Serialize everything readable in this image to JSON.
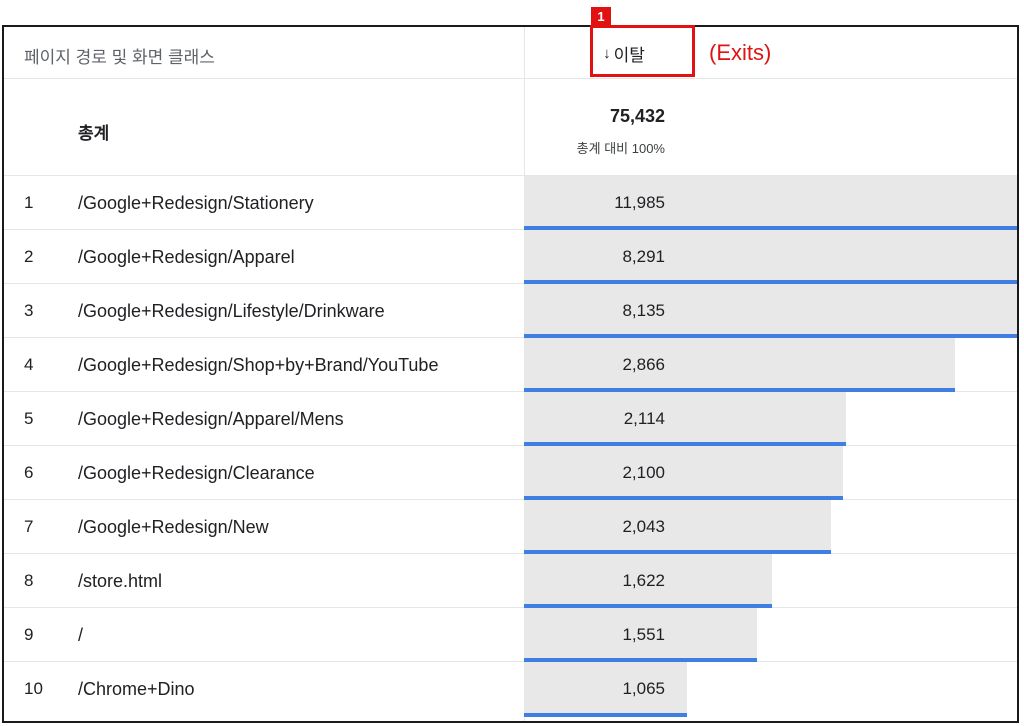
{
  "header": {
    "dimension_label": "페이지 경로 및 화면 클래스",
    "metric_label": "이탈",
    "sort_arrow": "↓"
  },
  "total": {
    "label": "총계",
    "value": "75,432",
    "sub": "총계 대비 100%"
  },
  "rows": [
    {
      "rank": "1",
      "path": "/Google+Redesign/Stationery",
      "value": "11,985"
    },
    {
      "rank": "2",
      "path": "/Google+Redesign/Apparel",
      "value": "8,291"
    },
    {
      "rank": "3",
      "path": "/Google+Redesign/Lifestyle/Drinkware",
      "value": "8,135"
    },
    {
      "rank": "4",
      "path": "/Google+Redesign/Shop+by+Brand/YouTube",
      "value": "2,866"
    },
    {
      "rank": "5",
      "path": "/Google+Redesign/Apparel/Mens",
      "value": "2,114"
    },
    {
      "rank": "6",
      "path": "/Google+Redesign/Clearance",
      "value": "2,100"
    },
    {
      "rank": "7",
      "path": "/Google+Redesign/New",
      "value": "2,043"
    },
    {
      "rank": "8",
      "path": "/store.html",
      "value": "1,622"
    },
    {
      "rank": "9",
      "path": "/",
      "value": "1,551"
    },
    {
      "rank": "10",
      "path": "/Chrome+Dino",
      "value": "1,065"
    }
  ],
  "bar_fill_fraction": [
    1.0,
    1.0,
    1.0,
    0.87,
    0.65,
    0.645,
    0.62,
    0.5,
    0.47,
    0.33
  ],
  "annotation": {
    "badge": "1",
    "note": "(Exits)",
    "color": "#e01212"
  },
  "colors": {
    "bar_fill": "#e8e8e8",
    "bar_line": "#3f7fe2"
  }
}
